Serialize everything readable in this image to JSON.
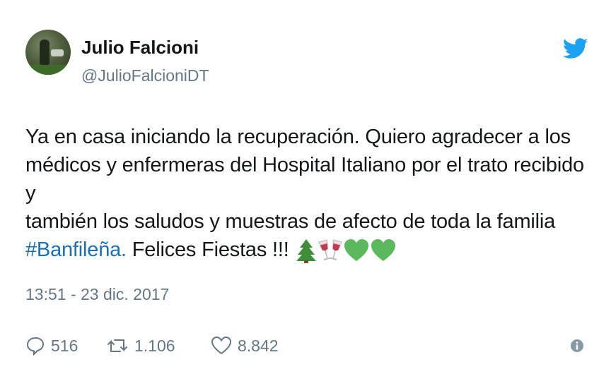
{
  "tweet": {
    "author_name": "Julio Falcioni",
    "author_handle": "@JulioFalcioniDT",
    "text_line1": "Ya en casa iniciando la recuperación. Quiero agradecer a los",
    "text_line2": "médicos y enfermeras del Hospital Italiano por el trato recibido y",
    "text_line3": "también los saludos y muestras de afecto de toda la familia",
    "hashtag": "#Banfileña.",
    "text_line4_rest": " Felices Fiestas !!!",
    "emojis": [
      "christmas-tree-icon",
      "clinking-glasses-icon",
      "green-heart-icon",
      "green-heart-icon"
    ],
    "timestamp": "13:51 - 23 dic. 2017"
  },
  "actions": {
    "replies": "516",
    "retweets": "1.106",
    "likes": "8.842"
  },
  "icons": {
    "brand": "twitter-bird-icon",
    "reply": "reply-bubble-icon",
    "retweet": "retweet-icon",
    "like": "heart-icon",
    "info": "info-icon"
  },
  "colors": {
    "twitter_blue": "#1da1f2",
    "hashtag": "#1b6fb5",
    "secondary_text": "#657786",
    "green_heart": "#5cb85c"
  }
}
